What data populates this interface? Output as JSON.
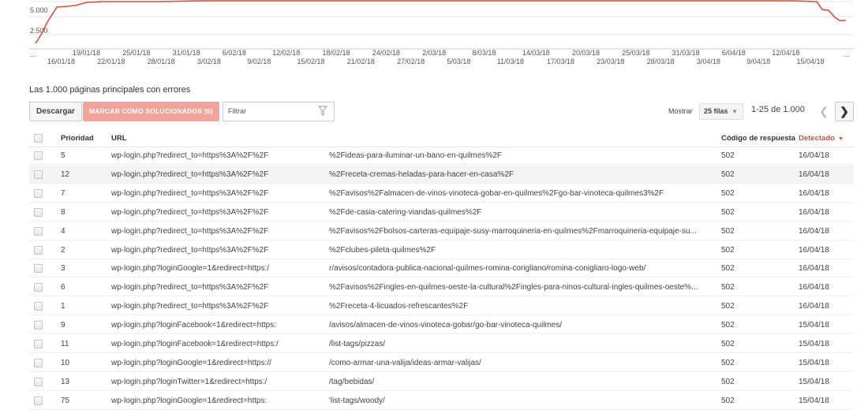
{
  "chart_data": {
    "type": "line",
    "y_ticks": [
      "5.000",
      "2.500"
    ],
    "x_ticks_top": [
      "19/01/18",
      "25/01/18",
      "31/01/18",
      "6/02/18",
      "12/02/18",
      "18/02/18",
      "24/02/18",
      "2/03/18",
      "8/03/18",
      "14/03/18",
      "20/03/18",
      "25/03/18",
      "31/03/18",
      "6/04/18",
      "12/04/18"
    ],
    "x_ticks_bottom": [
      "16/01/18",
      "22/01/18",
      "28/01/18",
      "3/02/18",
      "9/02/18",
      "15/02/18",
      "21/02/18",
      "27/02/18",
      "5/03/18",
      "11/03/18",
      "17/03/18",
      "23/03/18",
      "28/03/18",
      "3/04/18",
      "9/04/18",
      "15/04/18"
    ],
    "x_left_ellipsis": "...",
    "x_right_ellipsis": "...",
    "series_color": "#dd4b39",
    "grid": true
  },
  "section_title": "Las 1.000 páginas principales con errores",
  "toolbar": {
    "download_label": "Descargar",
    "mark_fixed_label": "MARCAR COMO SOLUCIONADOS (0)",
    "filter_placeholder": "Filtrar",
    "show_label": "Mostrar",
    "rows_select": "25 filas",
    "page_range": "1-25 de 1.000",
    "prev_icon": "chevron-left-icon",
    "next_icon": "chevron-right-icon"
  },
  "table": {
    "headers": {
      "priority": "Prioridad",
      "url": "URL",
      "code": "Código de respuesta",
      "detected": "Detectado"
    },
    "rows": [
      {
        "priority": "5",
        "url1": "wp-login.php?redirect_to=https%3A%2F%2F",
        "url2": "%2Fideas-para-iluminar-un-bano-en-quilmes%2F",
        "code": "502",
        "detected": "16/04/18"
      },
      {
        "priority": "12",
        "url1": "wp-login.php?redirect_to=https%3A%2F%2F",
        "url2": "%2Freceta-cremas-heladas-para-hacer-en-casa%2F",
        "code": "502",
        "detected": "16/04/18"
      },
      {
        "priority": "7",
        "url1": "wp-login.php?redirect_to=https%3A%2F%2F",
        "url2": "%2Favisos%2Falmacen-de-vinos-vinoteca-gobar-en-quilmes%2Fgo-bar-vinoteca-quilmes3%2F",
        "code": "502",
        "detected": "16/04/18"
      },
      {
        "priority": "8",
        "url1": "wp-login.php?redirect_to=https%3A%2F%2F",
        "url2": "%2Fde-casia-catering-viandas-quilmes%2F",
        "code": "502",
        "detected": "16/04/18"
      },
      {
        "priority": "4",
        "url1": "wp-login.php?redirect_to=https%3A%2F%2F",
        "url2": "%2Favisos%2Fbolsos-carteras-equipaje-susy-marroquineria-en-quilmes%2Fmarroquineria-equipaje-su...",
        "code": "502",
        "detected": "16/04/18"
      },
      {
        "priority": "2",
        "url1": "wp-login.php?redirect_to=https%3A%2F%2F",
        "url2": "%2Fclubes-pileta-quilmes%2F",
        "code": "502",
        "detected": "16/04/18"
      },
      {
        "priority": "3",
        "url1": "wp-login.php?loginGoogle=1&redirect=https:/",
        "url2": "r/avisos/contadora-publica-nacional-quilmes-romina-corigliano/romina-conigliaro-logo-web/",
        "code": "502",
        "detected": "16/04/18"
      },
      {
        "priority": "6",
        "url1": "wp-login.php?redirect_to=https%3A%2F%2F",
        "url2": "%2Favisos%2Fingles-en-quilmes-oeste-la-cultural%2Fingles-para-ninos-cultural-ingles-quilmes-oeste%...",
        "code": "502",
        "detected": "16/04/18"
      },
      {
        "priority": "1",
        "url1": "wp-login.php?redirect_to=https%3A%2F%2F",
        "url2": "%2Freceta-4-licuados-refrescantes%2F",
        "code": "502",
        "detected": "16/04/18"
      },
      {
        "priority": "9",
        "url1": "wp-login.php?loginFacebook=1&redirect=https:",
        "url2": "   /avisos/almacen-de-vinos-vinoteca-gobar/go-bar-vinoteca-quilmes/",
        "code": "502",
        "detected": "15/04/18"
      },
      {
        "priority": "11",
        "url1": "wp-login.php?loginFacebook=1&redirect=https:/",
        "url2": "   /list-tags/pizzas/",
        "code": "502",
        "detected": "15/04/18"
      },
      {
        "priority": "10",
        "url1": "wp-login.php?loginGoogle=1&redirect=https://",
        "url2": " /como-armar-una-valija/ideas-armar-valijas/",
        "code": "502",
        "detected": "15/04/18"
      },
      {
        "priority": "13",
        "url1": "wp-login.php?loginTwitter=1&redirect=https:/",
        "url2": "/tag/bebidas/",
        "code": "502",
        "detected": "15/04/18"
      },
      {
        "priority": "75",
        "url1": "wp-login.php?loginGoogle=1&redirect=https:",
        "url2": "'list-tags/woody/",
        "code": "502",
        "detected": "15/04/18"
      }
    ]
  }
}
